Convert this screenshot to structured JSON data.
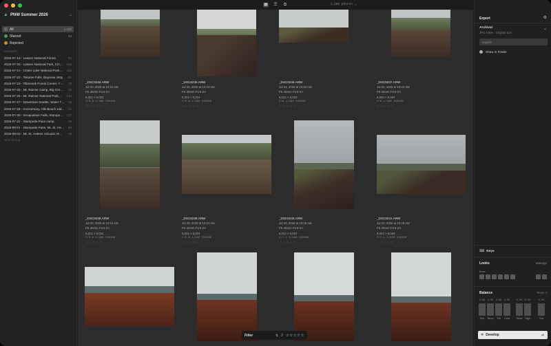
{
  "window": {
    "traffic": [
      "close",
      "minimize",
      "zoom"
    ]
  },
  "toolbar": {
    "view_icons": [
      "grid-view-icon",
      "list-view-icon",
      "compare-view-icon"
    ],
    "photo_count": "1,200 photos"
  },
  "sidebar": {
    "catalog": "PNW Summer 2026",
    "filters": [
      {
        "label": "All",
        "count": "1,200",
        "icon": "all-icon"
      },
      {
        "label": "Starred",
        "count": "53",
        "icon": "star-icon"
      },
      {
        "label": "Rejected",
        "count": "",
        "icon": "rejected-icon"
      }
    ],
    "groups_heading": "GROUPS",
    "groups": [
      {
        "label": "2026-07-19 - Lassen National Forest",
        "count": "50"
      },
      {
        "label": "2026-07-20 - Lassen National Park, Cin…",
        "count": "163"
      },
      {
        "label": "2026-07-21 - Crater Lake National Park…",
        "count": "222"
      },
      {
        "label": "2026-07-22 - Tokatee Falls, Bayview Jetty",
        "count": "81"
      },
      {
        "label": "2026-07-23 - Tillamook Forest Center, T…",
        "count": "78"
      },
      {
        "label": "2026-07-25 - Mt. Rainier Camp, Big Cree…",
        "count": "16"
      },
      {
        "label": "2026-07-26 - Mt. Rainier National Park,…",
        "count": "143"
      },
      {
        "label": "2026-07-27 - Downtown Seattle, Water T…",
        "count": "76"
      },
      {
        "label": "2026-07-28 - Anniversary, Alki Beach wal…",
        "count": "12"
      },
      {
        "label": "2026-07-30 - Snoqualmie Falls, Stampe…",
        "count": "137"
      },
      {
        "label": "2026-07-31 - Stampede Pass camp",
        "count": "36"
      },
      {
        "label": "2026-08-01 - Stampede Pass, Mt. St. Hel…",
        "count": "89"
      },
      {
        "label": "2026-08-02 - Mt. St. Helens Volcanic M…",
        "count": "76"
      }
    ],
    "new_group": "New Group"
  },
  "photos": [
    {
      "file": "_DSC8234.ARW",
      "date": "Jul 20, 2026 at 10:22 AM",
      "lens": "FE 35mm F2.8 ZA",
      "dims": "6,024 × 6,024",
      "exif": "f/5.6 1/160 ISO100",
      "rating": "☆☆☆☆☆"
    },
    {
      "file": "_DSC8235.ARW",
      "date": "Jul 20, 2026 at 10:23 AM",
      "lens": "FE 35mm F2.8 ZA",
      "dims": "6,024 × 6,024",
      "exif": "f/5.6 1/160 ISO100",
      "rating": "☆☆☆☆☆"
    },
    {
      "file": "_DSC8236.ARW",
      "date": "Jul 20, 2026 at 10:24 AM",
      "lens": "FE 35mm F2.8 ZA",
      "dims": "6,024 × 6,024",
      "exif": "f/8 1/160 ISO100",
      "rating": "☆☆☆☆☆"
    },
    {
      "file": "_DSC8237.ARW",
      "date": "Jul 20, 2026 at 10:24 AM",
      "lens": "FE 35mm F2.8 ZA",
      "dims": "6,024 × 6,024",
      "exif": "f/8 1/160 ISO100",
      "rating": "☆☆☆☆☆"
    },
    {
      "file": "_DSC8238.ARW",
      "date": "Jul 20, 2026 at 10:24 AM",
      "lens": "FE 35mm F2.8 ZA",
      "dims": "6,024 × 6,024",
      "exif": "f/5.6 1/160 ISO100",
      "rating": "☆☆☆☆☆"
    },
    {
      "file": "_DSC8239.ARW",
      "date": "Jul 20, 2026 at 10:24 AM",
      "lens": "FE 35mm F2.8 ZA",
      "dims": "6,024 × 6,024",
      "exif": "f/5.6 1/100 ISO100",
      "rating": "☆☆☆☆☆"
    },
    {
      "file": "_DSC8240.ARW",
      "date": "Jul 20, 2026 at 10:28 AM",
      "lens": "FE 35mm F2.8 ZA",
      "dims": "6,024 × 6,024",
      "exif": "f/7.1 1/100 ISO100",
      "rating": "☆☆☆☆☆"
    },
    {
      "file": "_DSC8241.ARW",
      "date": "Jul 20, 2026 at 10:29 AM",
      "lens": "FE 35mm F2.8 ZA",
      "dims": "6,024 × 6,024",
      "exif": "f/7.1 1/100 ISO100",
      "rating": "☆☆☆☆☆"
    }
  ],
  "filterbar": {
    "label": "Filter",
    "icon": "filter-icon",
    "count": "2",
    "stars": "☆☆☆☆☆"
  },
  "right": {
    "title": "Export",
    "preset_title": "Archival",
    "preset_sub": "JPG 100% · Original size",
    "export_label": "Export",
    "show_in_finder": "Show in Finder",
    "keys_label": "Keys",
    "looks_title": "Looks",
    "looks_manage": "Manage",
    "base_label": "Base",
    "balance_title": "Balance",
    "balance_reset": "Reset",
    "balance_values": [
      "0.00",
      "0.00",
      "0.00",
      "0.00",
      "0.00",
      "0.00",
      "0.00"
    ],
    "balance_labels": [
      "Exp",
      "Temp",
      "Tint",
      "Cont",
      "Shad",
      "High",
      "Sat"
    ],
    "develop_label": "Develop",
    "develop_key": "↵"
  },
  "colors": {
    "accent_green": "#3aa15c",
    "reject_orange": "#d48a2a",
    "sky_grey": "#b8bcc0",
    "ground_brown": "#4a3528",
    "red_ground": "#6b3520"
  }
}
